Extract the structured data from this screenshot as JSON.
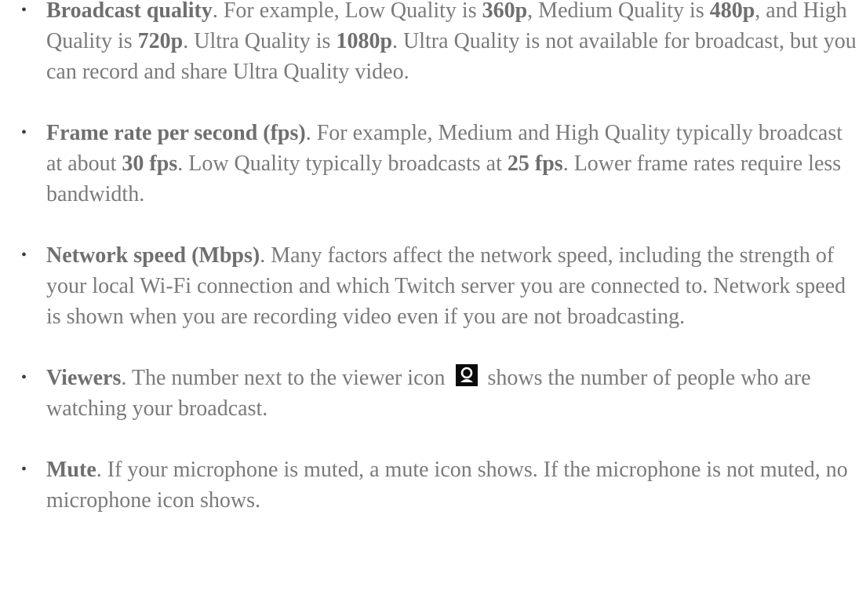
{
  "items": [
    {
      "title": "Broadcast quality",
      "segments": [
        ". For example, Low Quality is ",
        "360p",
        ", Medium Quality is ",
        "480p",
        ", and High Quality is ",
        "720p",
        ". Ultra Quality is ",
        "1080p",
        ". Ultra Quality is not available for broadcast, but you can record and share Ultra Quality video."
      ]
    },
    {
      "title": "Frame rate per second (fps)",
      "segments": [
        ". For example, Medium and High Quality typically broadcast at about ",
        "30 fps",
        ". Low Quality typically broadcasts at ",
        "25 fps",
        ". Lower frame rates require less bandwidth."
      ]
    },
    {
      "title": "Network speed (Mbps)",
      "segments": [
        ". Many factors affect the network speed, including the strength of your local Wi-Fi connection and which Twitch server you are connected to. Network speed is shown when you are recording video even if you are not broadcasting."
      ]
    },
    {
      "title": "Viewers",
      "segments": [
        ". The number next to the viewer icon",
        "shows the number of people who are watching your broadcast."
      ],
      "icon": "viewer-icon"
    },
    {
      "title": "Mute",
      "segments": [
        ". If your microphone is muted, a mute icon shows. If the microphone is not muted, no microphone icon shows."
      ]
    }
  ]
}
